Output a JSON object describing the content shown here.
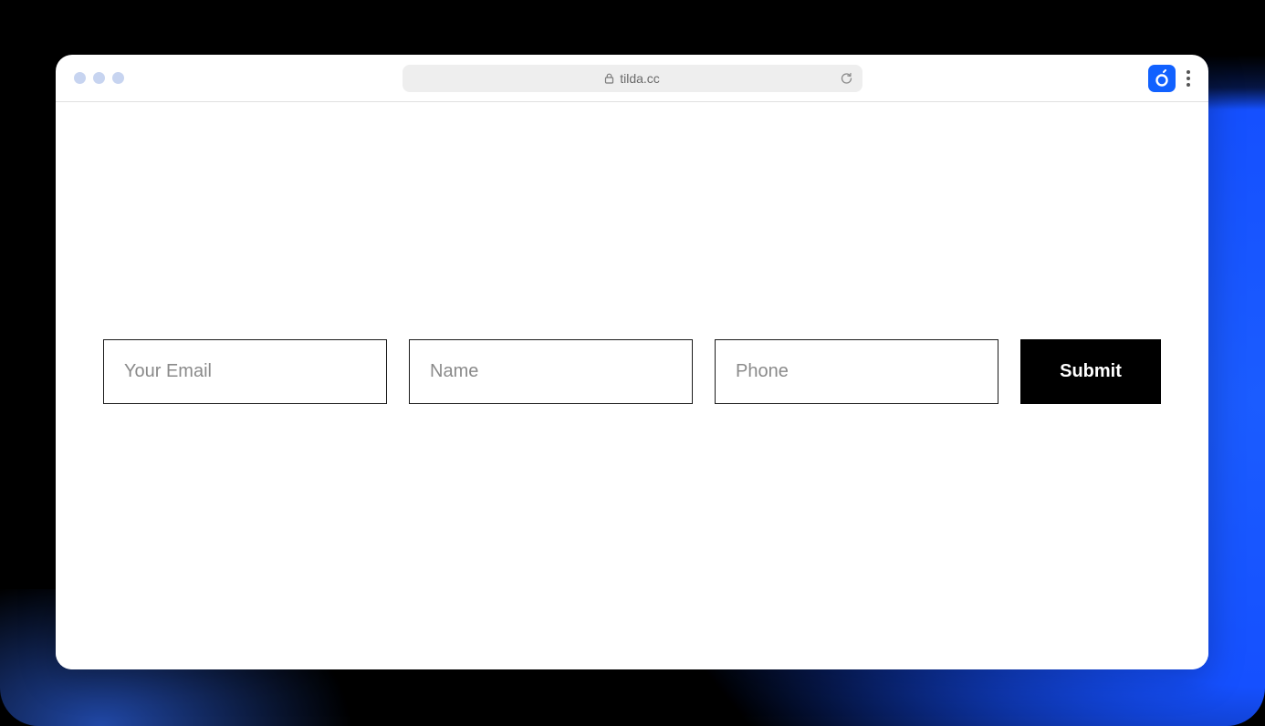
{
  "browser": {
    "url_display": "tilda.cc"
  },
  "form": {
    "email_placeholder": "Your Email",
    "name_placeholder": "Name",
    "phone_placeholder": "Phone",
    "submit_label": "Submit"
  },
  "colors": {
    "accent": "#1161ff",
    "button_bg": "#000000"
  }
}
